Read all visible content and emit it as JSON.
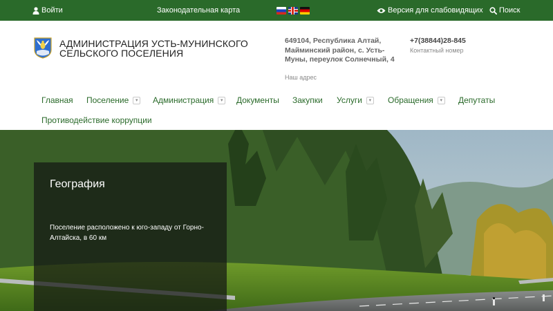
{
  "topbar": {
    "login_label": "Войти",
    "law_map_label": "Законодательная карта",
    "languages": [
      "ru",
      "en",
      "de"
    ],
    "low_vision_label": "Версия для слабовидящих",
    "search_label": "Поиск",
    "bg_color": "#2a6a2a"
  },
  "header": {
    "title_line1": "АДМИНИСТРАЦИЯ УСТЬ-МУНИНСКОГО",
    "title_line2": "СЕЛЬСКОГО ПОСЕЛЕНИЯ",
    "address_line1": "649104, Республика Алтай,",
    "address_line2": "Майминский район, с. Усть-",
    "address_line3": "Муны, переулок Солнечный, 4",
    "address_caption": "Наш адрес",
    "phone": "+7(38844)28-845",
    "phone_caption": "Контактный номер"
  },
  "nav": {
    "items": [
      {
        "label": "Главная",
        "has_dropdown": false
      },
      {
        "label": "Поселение",
        "has_dropdown": true
      },
      {
        "label": "Администрация",
        "has_dropdown": true
      },
      {
        "label": "Документы",
        "has_dropdown": false
      },
      {
        "label": "Закупки",
        "has_dropdown": false
      },
      {
        "label": "Услуги",
        "has_dropdown": true
      },
      {
        "label": "Обращения",
        "has_dropdown": true
      },
      {
        "label": "Депутаты",
        "has_dropdown": false
      },
      {
        "label": "Противодействие коррупции",
        "has_dropdown": false
      }
    ],
    "link_color": "#2a6a2a"
  },
  "hero": {
    "title": "География",
    "text": "Поселение расположено к юго-западу от Горно-Алтайска, в 60 км"
  }
}
